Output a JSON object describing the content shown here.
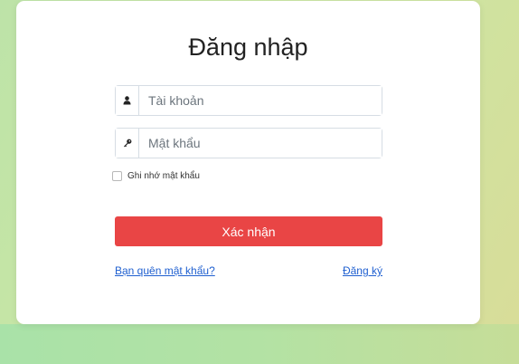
{
  "login": {
    "title": "Đăng nhập",
    "username": {
      "placeholder": "Tài khoản",
      "value": ""
    },
    "password": {
      "placeholder": "Mật khẩu",
      "value": ""
    },
    "remember_label": "Ghi nhớ mật khẩu",
    "remember_checked": false,
    "submit_label": "Xác nhận",
    "forgot_label": "Bạn quên mật khẩu?",
    "register_label": "Đăng ký"
  },
  "colors": {
    "primary_button": "#e94545",
    "link": "#2060d0"
  },
  "icons": {
    "username": "user-icon",
    "password": "key-icon"
  }
}
